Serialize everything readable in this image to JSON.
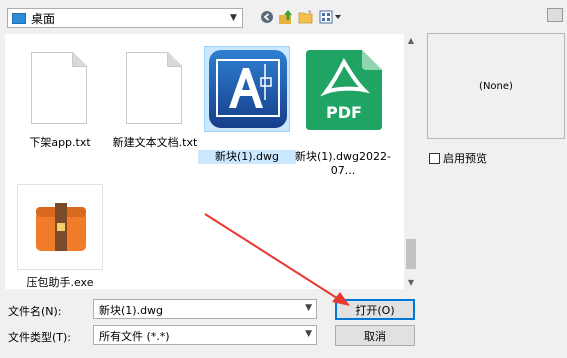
{
  "location": {
    "current": "桌面"
  },
  "files": [
    {
      "name": "下架app.txt",
      "selected": false
    },
    {
      "name": "新建文本文档.txt",
      "selected": false
    },
    {
      "name": "新块(1).dwg",
      "selected": true
    },
    {
      "name": "新块(1).dwg2022-07...",
      "selected": false
    },
    {
      "name": "压包助手.exe",
      "selected": false
    }
  ],
  "preview": {
    "none_text": "(None)",
    "enable_label": "启用预览"
  },
  "filename": {
    "label": "文件名(N):",
    "value": "新块(1).dwg"
  },
  "filetype": {
    "label": "文件类型(T):",
    "value": "所有文件 (*.*)"
  },
  "buttons": {
    "open": "打开(O)",
    "cancel": "取消"
  },
  "icons": {
    "pdf_text": "PDF"
  },
  "colors": {
    "arrow": "#e8382f",
    "selection": "#cce8ff",
    "pdf_green": "#1fa463",
    "dwg_blue": "#1d5aa8"
  }
}
